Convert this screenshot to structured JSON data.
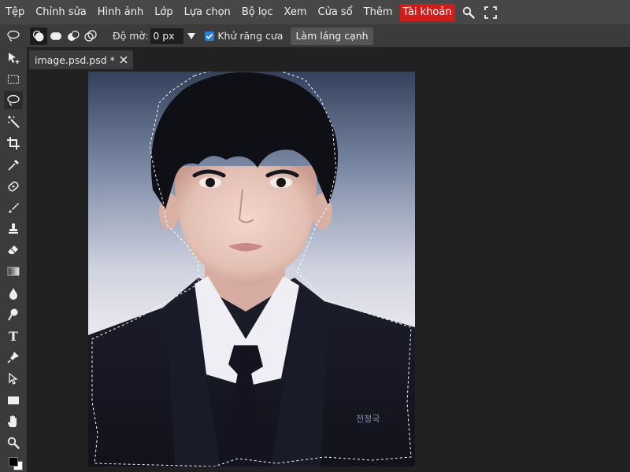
{
  "menu": {
    "items": [
      "Tệp",
      "Chỉnh sửa",
      "Hình ảnh",
      "Lớp",
      "Lựa chọn",
      "Bộ lọc",
      "Xem",
      "Cửa sổ",
      "Thêm"
    ],
    "account": "Tài khoản",
    "icons": [
      "search-icon",
      "fullscreen-icon"
    ],
    "account_color": "#d11c1c"
  },
  "options": {
    "tool_icon": "lasso-icon",
    "selection_modes": [
      "new-selection",
      "add-to-selection",
      "subtract-from-selection",
      "intersect-selection"
    ],
    "active_mode": "new-selection",
    "feather_label": "Độ mờ:",
    "feather_value": "0 px",
    "antialias_label": "Khử răng cưa",
    "antialias_checked": true,
    "refine_edge_label": "Làm láng cạnh"
  },
  "tools": [
    "move",
    "marquee",
    "lasso",
    "magic-wand",
    "crop",
    "eyedropper",
    "spot-heal",
    "brush",
    "clone-stamp",
    "eraser",
    "gradient",
    "blur",
    "dodge",
    "type",
    "pen",
    "path-select",
    "shape",
    "hand",
    "zoom"
  ],
  "active_tool": "lasso",
  "type_tool_glyph": "T",
  "tab": {
    "title": "image.psd.psd *"
  },
  "colors": {
    "foreground": "#000000",
    "background": "#ffffff",
    "accent": "#2a7fd4"
  },
  "photo": {
    "name_tag": "전정국"
  }
}
